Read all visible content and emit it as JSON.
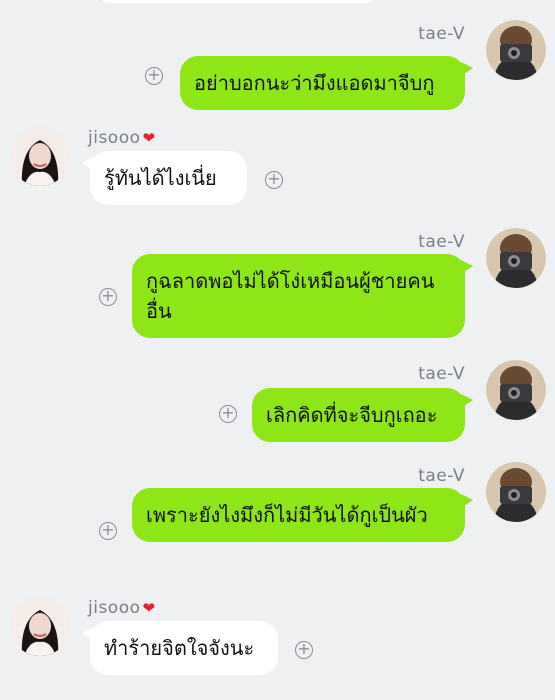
{
  "messages": [
    {
      "sender": "tae-V",
      "text": "อย่าบอกนะว่ามึงแอดมาจีบกู"
    },
    {
      "sender": "jisooo",
      "text": "รู้ทันได้ไงเนี่ย"
    },
    {
      "sender": "tae-V",
      "text": "กูฉลาดพอไม่ได้โง่เหมือนผู้ชายคนอื่น"
    },
    {
      "sender": "tae-V",
      "text": "เลิกคิดที่จะจีบกูเถอะ"
    },
    {
      "sender": "tae-V",
      "text": "เพราะยังไงมึงก็ไม่มีวันได้กูเป็นผัว"
    },
    {
      "sender": "jisooo",
      "text": "ทำร้ายจิตใจจังนะ"
    }
  ],
  "colors": {
    "outgoing_bubble": "#8fe617",
    "incoming_bubble": "#ffffff",
    "background": "#eef0f2"
  },
  "icons": {
    "add": "plus-circle-icon",
    "sender_decoration": "kiss-lips-icon"
  }
}
